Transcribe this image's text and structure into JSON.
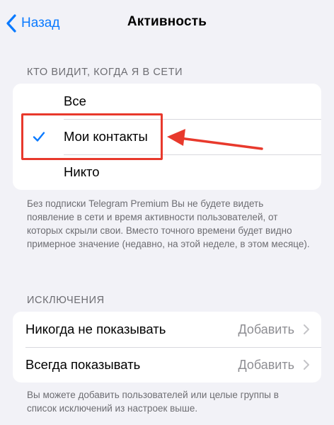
{
  "nav": {
    "back_label": "Назад",
    "title": "Активность"
  },
  "visibility": {
    "header": "КТО ВИДИТ, КОГДА Я В СЕТИ",
    "options": [
      {
        "label": "Все",
        "selected": false
      },
      {
        "label": "Мои контакты",
        "selected": true
      },
      {
        "label": "Никто",
        "selected": false
      }
    ],
    "footnote": "Без подписки Telegram Premium Вы не будете видеть появление в сети и время активности пользователей, от которых скрыли свои. Вместо точного времени будет видно примерное значение (недавно, на этой неделе, в этом месяце)."
  },
  "exceptions": {
    "header": "ИСКЛЮЧЕНИЯ",
    "rows": [
      {
        "label": "Никогда не показывать",
        "value": "Добавить"
      },
      {
        "label": "Всегда показывать",
        "value": "Добавить"
      }
    ],
    "footnote": "Вы можете добавить пользователей или целые группы в список исключений из настроек выше."
  },
  "colors": {
    "accent": "#0a7aff",
    "annotation": "#e8392c",
    "background": "#f2f2f7"
  },
  "icons": {
    "back": "chevron-left-icon",
    "check": "checkmark-icon",
    "disclosure": "chevron-right-icon"
  }
}
